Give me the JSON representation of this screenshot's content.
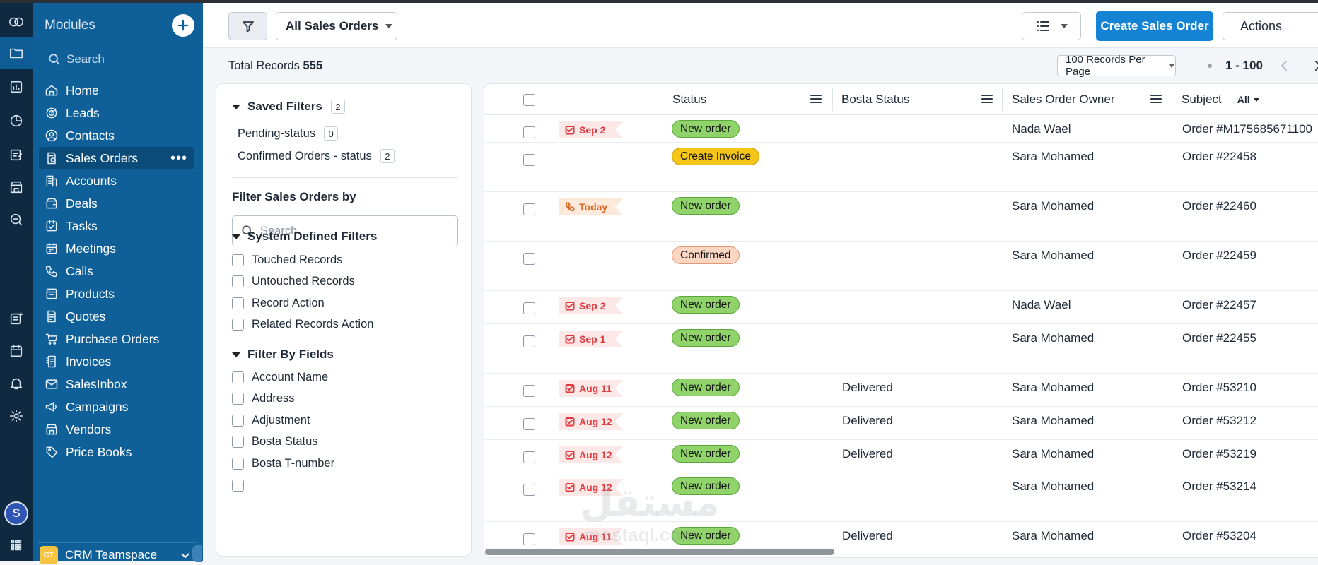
{
  "sidebar": {
    "title": "Modules",
    "search_placeholder": "Search",
    "items": [
      {
        "label": "Home",
        "icon": "home-icon"
      },
      {
        "label": "Leads",
        "icon": "leads-icon"
      },
      {
        "label": "Contacts",
        "icon": "contacts-icon"
      },
      {
        "label": "Sales Orders",
        "icon": "sales-orders-icon",
        "active": true
      },
      {
        "label": "Accounts",
        "icon": "accounts-icon"
      },
      {
        "label": "Deals",
        "icon": "deals-icon"
      },
      {
        "label": "Tasks",
        "icon": "tasks-icon"
      },
      {
        "label": "Meetings",
        "icon": "meetings-icon"
      },
      {
        "label": "Calls",
        "icon": "calls-icon"
      },
      {
        "label": "Products",
        "icon": "products-icon"
      },
      {
        "label": "Quotes",
        "icon": "quotes-icon"
      },
      {
        "label": "Purchase Orders",
        "icon": "purchase-orders-icon"
      },
      {
        "label": "Invoices",
        "icon": "invoices-icon"
      },
      {
        "label": "SalesInbox",
        "icon": "salesinbox-icon"
      },
      {
        "label": "Campaigns",
        "icon": "campaigns-icon"
      },
      {
        "label": "Vendors",
        "icon": "vendors-icon"
      },
      {
        "label": "Price Books",
        "icon": "price-books-icon"
      }
    ],
    "more_label": "•••",
    "teamspace": {
      "badge": "CT",
      "label": "CRM Teamspace"
    }
  },
  "rail": {
    "avatar_initial": "S"
  },
  "toolbar": {
    "view_label": "All Sales Orders",
    "create_label": "Create Sales Order",
    "actions_label": "Actions"
  },
  "records": {
    "total_label": "Total Records",
    "total_value": "555",
    "per_page": "100 Records Per Page",
    "range": "1 - 100"
  },
  "filters": {
    "saved_title": "Saved Filters",
    "saved_count": "2",
    "saved_items": [
      {
        "label": "Pending-status",
        "count": "0"
      },
      {
        "label": "Confirmed Orders - status",
        "count": "2"
      }
    ],
    "filter_by_title": "Filter Sales Orders by",
    "search_placeholder": "Search",
    "system_title": "System Defined Filters",
    "system_items": [
      "Touched Records",
      "Untouched Records",
      "Record Action",
      "Related Records Action"
    ],
    "fields_title": "Filter By Fields",
    "field_items": [
      "Account Name",
      "Address",
      "Adjustment",
      "Bosta Status",
      "Bosta T-number"
    ]
  },
  "table": {
    "columns": {
      "status": "Status",
      "bosta_status": "Bosta Status",
      "owner": "Sales Order Owner",
      "subject": "Subject",
      "subject_filter": "All"
    },
    "rows": [
      {
        "due": "Sep 2",
        "due_kind": "task",
        "status": "New order",
        "status_color": "green",
        "bosta": "",
        "owner": "Nada Wael",
        "subject": "Order #M175685671100"
      },
      {
        "due": "",
        "due_kind": "",
        "status": "Create Invoice",
        "status_color": "yellow",
        "bosta": "",
        "owner": "Sara Mohamed",
        "subject": "Order #22458"
      },
      {
        "due": "Today",
        "due_kind": "call",
        "status": "New order",
        "status_color": "green",
        "bosta": "",
        "owner": "Sara Mohamed",
        "subject": "Order #22460"
      },
      {
        "due": "",
        "due_kind": "",
        "status": "Confirmed",
        "status_color": "peach",
        "bosta": "",
        "owner": "Sara Mohamed",
        "subject": "Order #22459"
      },
      {
        "due": "Sep 2",
        "due_kind": "task",
        "status": "New order",
        "status_color": "green",
        "bosta": "",
        "owner": "Nada Wael",
        "subject": "Order #22457"
      },
      {
        "due": "Sep 1",
        "due_kind": "task",
        "status": "New order",
        "status_color": "green",
        "bosta": "",
        "owner": "Sara Mohamed",
        "subject": "Order #22455"
      },
      {
        "due": "Aug 11",
        "due_kind": "task",
        "status": "New order",
        "status_color": "green",
        "bosta": "Delivered",
        "owner": "Sara Mohamed",
        "subject": "Order #53210"
      },
      {
        "due": "Aug 12",
        "due_kind": "task",
        "status": "New order",
        "status_color": "green",
        "bosta": "Delivered",
        "owner": "Sara Mohamed",
        "subject": "Order #53212"
      },
      {
        "due": "Aug 12",
        "due_kind": "task",
        "status": "New order",
        "status_color": "green",
        "bosta": "Delivered",
        "owner": "Sara Mohamed",
        "subject": "Order #53219"
      },
      {
        "due": "Aug 12",
        "due_kind": "task",
        "status": "New order",
        "status_color": "green",
        "bosta": "",
        "owner": "Sara Mohamed",
        "subject": "Order #53214"
      },
      {
        "due": "Aug 11",
        "due_kind": "task",
        "status": "New order",
        "status_color": "green",
        "bosta": "Delivered",
        "owner": "Sara Mohamed",
        "subject": "Order #53204"
      }
    ]
  },
  "watermark": {
    "arabic": "مستقل",
    "latin": "mostaql.com"
  },
  "colors": {
    "sidebar": "#0f5f99",
    "rail": "#0f2940",
    "primary_button": "#1483d4",
    "status_green": "#8fd36a",
    "status_yellow": "#f5c518",
    "status_peach": "#fbd6c3",
    "due_red": "#e0393e"
  }
}
